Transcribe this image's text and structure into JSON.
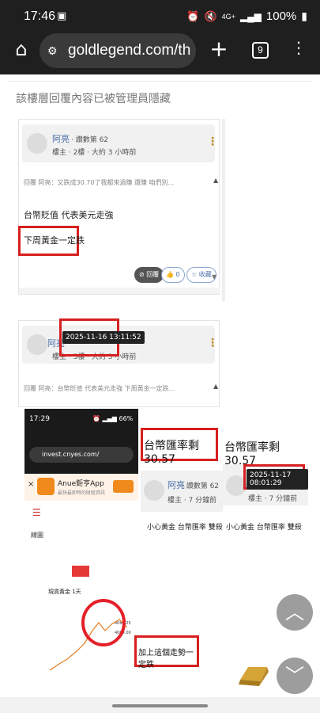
{
  "status": {
    "time": "17:46",
    "battery": "100%",
    "network": "4G+"
  },
  "browser": {
    "url": "goldlegend.com/th",
    "tab_count": "9"
  },
  "hidden_message": "該樓層回覆內容已被管理員隱藏",
  "post1": {
    "username": "阿亮",
    "chip": "· 讚數第 62",
    "meta": "樓主 · 2樓 · 大約 3 小時前",
    "quote": "回覆 阿亮：又跌成30.70了我都來過賺 還賺 咱們別...",
    "line1": "台幣貶值 代表美元走強",
    "line2": "下周黃金一定跌",
    "reply_label": "回覆",
    "like_label": "0",
    "fav_label": "收藏"
  },
  "post2": {
    "username": "阿亮",
    "meta": "樓主 · 3樓 · 大約 3 小時前",
    "tooltip": "2025-11-16 13:11:52",
    "quote": "回覆 阿亮：台幣貶值 代表美元走強 下周黃金一定跌..."
  },
  "embedded": {
    "phone_time": "17:29",
    "app_url": "invest.cnyes.com/",
    "app_title": "Anue鉅亨App",
    "app_sub": "最快最即時的財經資訊",
    "chart_label": "線圖",
    "gold_label": "現貨黃金 1天",
    "price1": "4080.25",
    "price2": "4000.00",
    "headline1": "台幣匯率剩30.57",
    "headline2": "台幣匯率剩30.57",
    "username": "阿亮",
    "chip": "· 讚數第 62",
    "meta": "樓主 · 7 分鐘前",
    "meta2": "樓主 · 7 分鐘前",
    "tooltip": "2025-11-17 08:01:29",
    "text1": "小心黃金 台幣匯率 雙殺",
    "text2": "小心黃金 台幣匯率 雙殺",
    "caption": "加上這個走勢一定跌"
  }
}
